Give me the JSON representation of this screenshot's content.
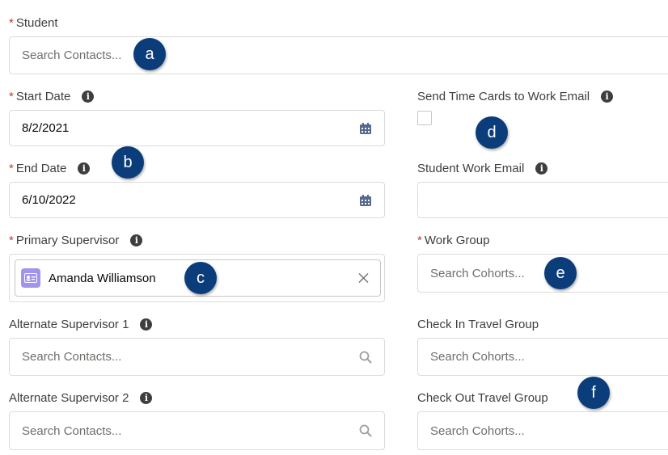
{
  "fields": {
    "student": {
      "label": "Student",
      "placeholder": "Search Contacts..."
    },
    "start_date": {
      "label": "Start Date",
      "value": "8/2/2021"
    },
    "end_date": {
      "label": "End Date",
      "value": "6/10/2022"
    },
    "primary_supervisor": {
      "label": "Primary Supervisor",
      "value": "Amanda Williamson"
    },
    "alternate_supervisor_1": {
      "label": "Alternate Supervisor 1",
      "placeholder": "Search Contacts..."
    },
    "alternate_supervisor_2": {
      "label": "Alternate Supervisor 2",
      "placeholder": "Search Contacts..."
    },
    "send_time_cards": {
      "label": "Send Time Cards to Work Email",
      "checked": false
    },
    "student_work_email": {
      "label": "Student Work Email",
      "value": ""
    },
    "work_group": {
      "label": "Work Group",
      "placeholder": "Search Cohorts..."
    },
    "check_in_travel_group": {
      "label": "Check In Travel Group",
      "placeholder": "Search Cohorts..."
    },
    "check_out_travel_group": {
      "label": "Check Out Travel Group",
      "placeholder": "Search Cohorts..."
    }
  },
  "required_marker": "*",
  "info_glyph": "i",
  "callouts": {
    "a": "a",
    "b": "b",
    "c": "c",
    "d": "d",
    "e": "e",
    "f": "f"
  },
  "colors": {
    "required": "#c23934",
    "callout": "#0b3d7a",
    "avatar": "#a094ed",
    "icon": "#54698d"
  },
  "icons": {
    "calendar": "calendar-icon",
    "search": "search-icon",
    "clear": "close-icon",
    "contact": "contact-card-icon",
    "info": "info-icon"
  }
}
